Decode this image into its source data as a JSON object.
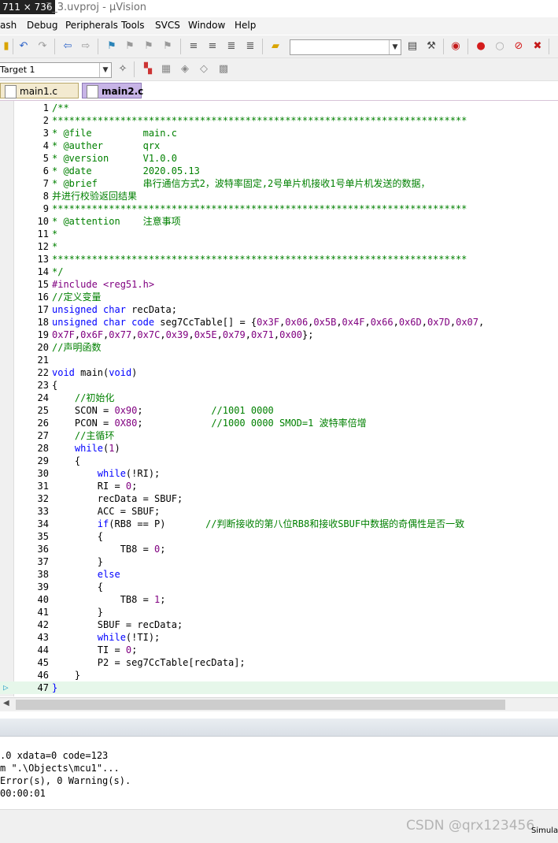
{
  "window": {
    "dim_label": "711 × 736",
    "title": "7_3.uvproj - µVision"
  },
  "menu": [
    "ash",
    "Debug",
    "Peripherals",
    "Tools",
    "SVCS",
    "Window",
    "Help"
  ],
  "toolbar2": {
    "target_label": "Target 1"
  },
  "tabs": [
    {
      "label": "main1.c",
      "active": false
    },
    {
      "label": "main2.c",
      "active": true
    }
  ],
  "editor": {
    "current_line": 47,
    "lines": [
      [
        {
          "t": "/**",
          "c": "cm"
        }
      ],
      [
        {
          "t": "*************************************************************************",
          "c": "cm"
        }
      ],
      [
        {
          "t": "* @file         main.c",
          "c": "cm"
        }
      ],
      [
        {
          "t": "* @auther       qrx",
          "c": "cm"
        }
      ],
      [
        {
          "t": "* @version      V1.0.0",
          "c": "cm"
        }
      ],
      [
        {
          "t": "* @date         2020.05.13",
          "c": "cm"
        }
      ],
      [
        {
          "t": "* @brief        串行通信方式2，波特率固定,2号单片机接收1号单片机发送的数据，",
          "c": "cm"
        }
      ],
      [
        {
          "t": "并进行校验返回结果",
          "c": "cm"
        }
      ],
      [
        {
          "t": "*************************************************************************",
          "c": "cm"
        }
      ],
      [
        {
          "t": "* @attention    注意事项",
          "c": "cm"
        }
      ],
      [
        {
          "t": "*",
          "c": "cm"
        }
      ],
      [
        {
          "t": "*",
          "c": "cm"
        }
      ],
      [
        {
          "t": "*************************************************************************",
          "c": "cm"
        }
      ],
      [
        {
          "t": "*/",
          "c": "cm"
        }
      ],
      [
        {
          "t": "#include <reg51.h>",
          "c": "pp"
        }
      ],
      [
        {
          "t": "//定义变量",
          "c": "cm"
        }
      ],
      [
        {
          "t": "unsigned",
          "c": "kw"
        },
        {
          "t": " ",
          "c": "id"
        },
        {
          "t": "char",
          "c": "kw"
        },
        {
          "t": " recData;",
          "c": "id"
        }
      ],
      [
        {
          "t": "unsigned",
          "c": "kw"
        },
        {
          "t": " ",
          "c": "id"
        },
        {
          "t": "char",
          "c": "kw"
        },
        {
          "t": " ",
          "c": "id"
        },
        {
          "t": "code",
          "c": "kw"
        },
        {
          "t": " seg7CcTable[] = {",
          "c": "id"
        },
        {
          "t": "0x3F",
          "c": "num"
        },
        {
          "t": ",",
          "c": "id"
        },
        {
          "t": "0x06",
          "c": "num"
        },
        {
          "t": ",",
          "c": "id"
        },
        {
          "t": "0x5B",
          "c": "num"
        },
        {
          "t": ",",
          "c": "id"
        },
        {
          "t": "0x4F",
          "c": "num"
        },
        {
          "t": ",",
          "c": "id"
        },
        {
          "t": "0x66",
          "c": "num"
        },
        {
          "t": ",",
          "c": "id"
        },
        {
          "t": "0x6D",
          "c": "num"
        },
        {
          "t": ",",
          "c": "id"
        },
        {
          "t": "0x7D",
          "c": "num"
        },
        {
          "t": ",",
          "c": "id"
        },
        {
          "t": "0x07",
          "c": "num"
        },
        {
          "t": ",",
          "c": "id"
        }
      ],
      [
        {
          "t": "0x7F",
          "c": "num"
        },
        {
          "t": ",",
          "c": "id"
        },
        {
          "t": "0x6F",
          "c": "num"
        },
        {
          "t": ",",
          "c": "id"
        },
        {
          "t": "0x77",
          "c": "num"
        },
        {
          "t": ",",
          "c": "id"
        },
        {
          "t": "0x7C",
          "c": "num"
        },
        {
          "t": ",",
          "c": "id"
        },
        {
          "t": "0x39",
          "c": "num"
        },
        {
          "t": ",",
          "c": "id"
        },
        {
          "t": "0x5E",
          "c": "num"
        },
        {
          "t": ",",
          "c": "id"
        },
        {
          "t": "0x79",
          "c": "num"
        },
        {
          "t": ",",
          "c": "id"
        },
        {
          "t": "0x71",
          "c": "num"
        },
        {
          "t": ",",
          "c": "id"
        },
        {
          "t": "0x00",
          "c": "num"
        },
        {
          "t": "};",
          "c": "id"
        }
      ],
      [
        {
          "t": "//声明函数",
          "c": "cm"
        }
      ],
      [],
      [
        {
          "t": "void",
          "c": "kw"
        },
        {
          "t": " main(",
          "c": "id"
        },
        {
          "t": "void",
          "c": "kw"
        },
        {
          "t": ")",
          "c": "id"
        }
      ],
      [
        {
          "t": "{",
          "c": "id"
        }
      ],
      [
        {
          "t": "    //初始化",
          "c": "cm"
        }
      ],
      [
        {
          "t": "    SCON = ",
          "c": "id"
        },
        {
          "t": "0x90",
          "c": "num"
        },
        {
          "t": ";            ",
          "c": "id"
        },
        {
          "t": "//1001 0000",
          "c": "cm"
        }
      ],
      [
        {
          "t": "    PCON = ",
          "c": "id"
        },
        {
          "t": "0X80",
          "c": "num"
        },
        {
          "t": ";            ",
          "c": "id"
        },
        {
          "t": "//1000 0000 SMOD=1 波特率倍增",
          "c": "cm"
        }
      ],
      [
        {
          "t": "    //主循环",
          "c": "cm"
        }
      ],
      [
        {
          "t": "    ",
          "c": "id"
        },
        {
          "t": "while",
          "c": "kw"
        },
        {
          "t": "(",
          "c": "id"
        },
        {
          "t": "1",
          "c": "num"
        },
        {
          "t": ")",
          "c": "id"
        }
      ],
      [
        {
          "t": "    {",
          "c": "id"
        }
      ],
      [
        {
          "t": "        ",
          "c": "id"
        },
        {
          "t": "while",
          "c": "kw"
        },
        {
          "t": "(!RI);",
          "c": "id"
        }
      ],
      [
        {
          "t": "        RI = ",
          "c": "id"
        },
        {
          "t": "0",
          "c": "num"
        },
        {
          "t": ";",
          "c": "id"
        }
      ],
      [
        {
          "t": "        recData = SBUF;",
          "c": "id"
        }
      ],
      [
        {
          "t": "        ACC = SBUF;",
          "c": "id"
        }
      ],
      [
        {
          "t": "        ",
          "c": "id"
        },
        {
          "t": "if",
          "c": "kw"
        },
        {
          "t": "(RB8 == P)       ",
          "c": "id"
        },
        {
          "t": "//判断接收的第八位RB8和接收SBUF中数据的奇偶性是否一致",
          "c": "cm"
        }
      ],
      [
        {
          "t": "        {",
          "c": "id"
        }
      ],
      [
        {
          "t": "            TB8 = ",
          "c": "id"
        },
        {
          "t": "0",
          "c": "num"
        },
        {
          "t": ";",
          "c": "id"
        }
      ],
      [
        {
          "t": "        }",
          "c": "id"
        }
      ],
      [
        {
          "t": "        ",
          "c": "id"
        },
        {
          "t": "else",
          "c": "kw"
        }
      ],
      [
        {
          "t": "        {",
          "c": "id"
        }
      ],
      [
        {
          "t": "            TB8 = ",
          "c": "id"
        },
        {
          "t": "1",
          "c": "num"
        },
        {
          "t": ";",
          "c": "id"
        }
      ],
      [
        {
          "t": "        }",
          "c": "id"
        }
      ],
      [
        {
          "t": "        SBUF = recData;",
          "c": "id"
        }
      ],
      [
        {
          "t": "        ",
          "c": "id"
        },
        {
          "t": "while",
          "c": "kw"
        },
        {
          "t": "(!TI);",
          "c": "id"
        }
      ],
      [
        {
          "t": "        TI = ",
          "c": "id"
        },
        {
          "t": "0",
          "c": "num"
        },
        {
          "t": ";",
          "c": "id"
        }
      ],
      [
        {
          "t": "        P2 = seg7CcTable[recData];",
          "c": "id"
        }
      ],
      [
        {
          "t": "    }",
          "c": "id"
        }
      ],
      [
        {
          "t": "}",
          "c": "kw"
        }
      ]
    ]
  },
  "output": {
    "lines": [
      ".0 xdata=0 code=123",
      "m \".\\Objects\\mcu1\"...",
      "Error(s), 0 Warning(s).",
      "00:00:01"
    ]
  },
  "status": {
    "simulation": "Simula"
  },
  "watermark": "CSDN @qrx123456"
}
